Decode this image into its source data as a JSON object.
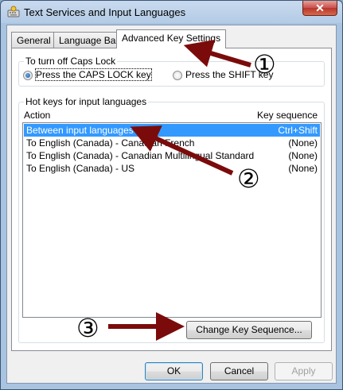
{
  "window": {
    "title": "Text Services and Input Languages",
    "close_label": "✕"
  },
  "tabs": [
    {
      "label": "General"
    },
    {
      "label": "Language Bar"
    },
    {
      "label": "Advanced Key Settings"
    }
  ],
  "caps_lock": {
    "group_label": "To turn off Caps Lock",
    "option_caps": "Press the CAPS LOCK key",
    "option_shift": "Press the SHIFT key",
    "selected": "option_caps"
  },
  "hotkeys": {
    "group_label": "Hot keys for input languages",
    "col_action": "Action",
    "col_sequence": "Key sequence",
    "rows": [
      {
        "action": "Between input languages",
        "sequence": "Ctrl+Shift"
      },
      {
        "action": "To English (Canada) - Canadian French",
        "sequence": "(None)"
      },
      {
        "action": "To English (Canada) - Canadian Multilingual Standard",
        "sequence": "(None)"
      },
      {
        "action": "To English (Canada) - US",
        "sequence": "(None)"
      }
    ],
    "change_button": "Change Key Sequence..."
  },
  "buttons": {
    "ok": "OK",
    "cancel": "Cancel",
    "apply": "Apply"
  },
  "annotations": [
    "①",
    "②",
    "③"
  ],
  "colors": {
    "arrow": "#7b0b0b",
    "selection": "#3399ff"
  }
}
